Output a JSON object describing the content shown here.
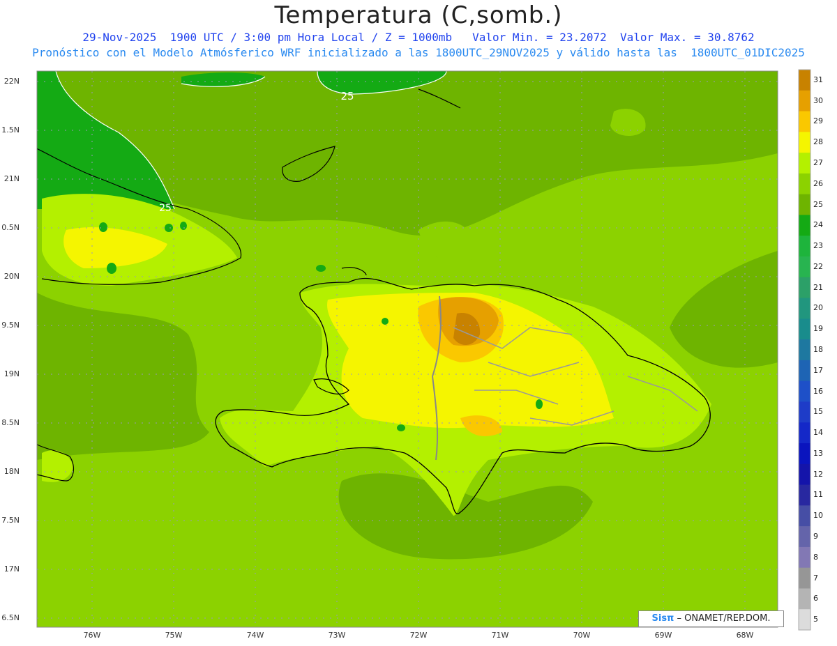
{
  "header": {
    "title": "Temperatura (C,somb.)",
    "line1": "29-Nov-2025  1900 UTC / 3:00 pm Hora Local / Z = 1000mb   Valor Min. = 23.2072  Valor Max. = 30.8762",
    "line2": "Pronóstico con el Modelo Atmósferico WRF inicializado a las 1800UTC_29NOV2025 y válido hasta las  1800UTC_01DIC2025"
  },
  "axes": {
    "y_labels": [
      "22N",
      "1.5N",
      "21N",
      "0.5N",
      "20N",
      "9.5N",
      "19N",
      "8.5N",
      "18N",
      "7.5N",
      "17N",
      "6.5N"
    ],
    "x_labels": [
      "76W",
      "75W",
      "74W",
      "73W",
      "72W",
      "71W",
      "70W",
      "69W",
      "68W"
    ]
  },
  "contour_labels": [
    "25",
    "25"
  ],
  "colorbar": {
    "labels": [
      "31",
      "30",
      "29",
      "28",
      "27",
      "26",
      "25",
      "24",
      "23",
      "22",
      "21",
      "20",
      "19",
      "18",
      "17",
      "16",
      "15",
      "14",
      "13",
      "12",
      "11",
      "10",
      "9",
      "8",
      "7",
      "6",
      "5"
    ],
    "colors": [
      "#c88200",
      "#e6a000",
      "#fac800",
      "#f5f500",
      "#b4f000",
      "#8cd200",
      "#6eb400",
      "#14aa14",
      "#1eb43c",
      "#28b450",
      "#2ca068",
      "#21967e",
      "#198c8c",
      "#1e78a0",
      "#1e64b4",
      "#1e50c8",
      "#1e3cc8",
      "#1428c8",
      "#0a14be",
      "#1414aa",
      "#2828a0",
      "#464ea5",
      "#6464aa",
      "#8278b4",
      "#969696",
      "#b4b4b4",
      "#dcdcdc"
    ]
  },
  "credit": {
    "sis": "Sisπ",
    "rest": " – ONAMET/REP.DOM."
  }
}
